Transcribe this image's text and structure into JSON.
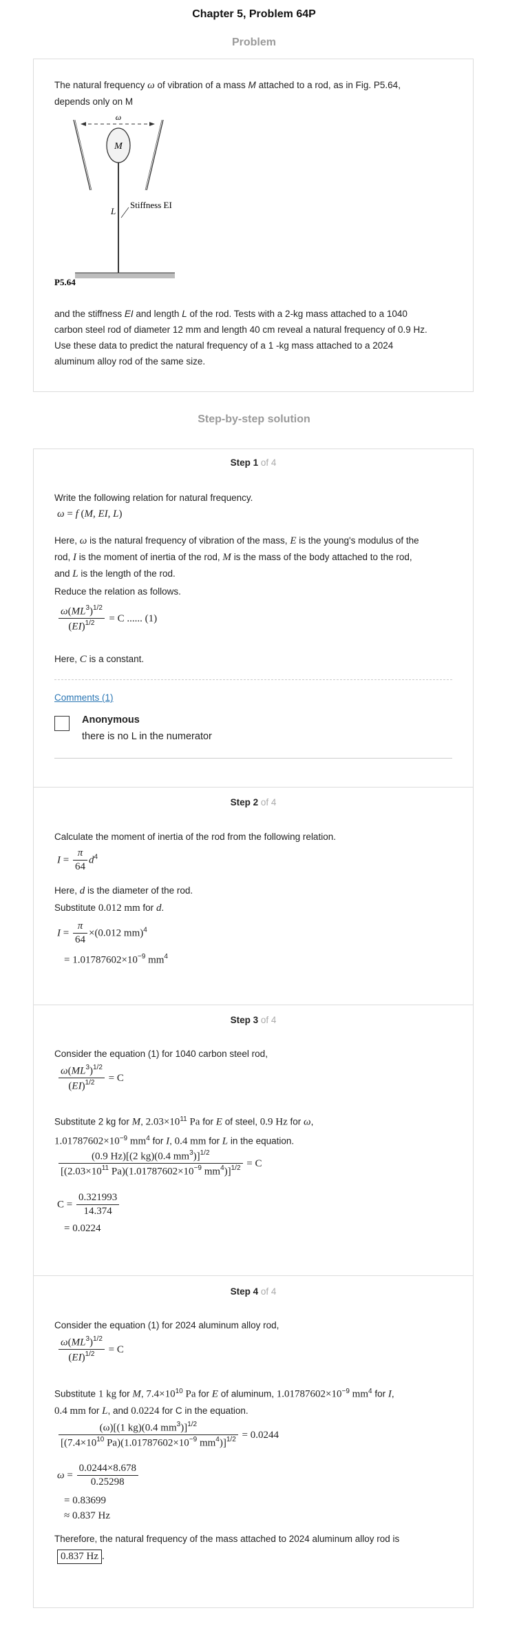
{
  "title": "Chapter 5, Problem 64P",
  "problem_heading": "Problem",
  "problem": {
    "line1a": "The natural frequency",
    "omega": "ω",
    "line1b": "of vibration of a mass",
    "mass_var": "M",
    "line1c": "attached to a rod, as in Fig. P5.64,",
    "line2": "depends only on M",
    "figure": {
      "omega_label": "ω",
      "mass_label": "M",
      "length_label": "L",
      "stiffness_label": "Stiffness EI",
      "figure_id": "P5.64"
    },
    "para2a": "and the stiffness",
    "ei": "EI",
    "para2b": "and length",
    "l": "L",
    "para2c": "of the rod. Tests with a 2-kg mass attached to a 1040",
    "para2_line2": "carbon steel rod of diameter 12 mm and length 40 cm reveal a natural frequency of 0.9 Hz.",
    "para2_line3": "Use these data to predict the natural frequency of a 1 -kg mass attached to a 2024",
    "para2_line4": "aluminum alloy rod of the same size."
  },
  "solution_heading": "Step-by-step solution",
  "steps": [
    {
      "label": "Step 1",
      "of": "of 4",
      "intro": "Write the following relation for natural frequency.",
      "eq1": "ω = f (M, EI, L)",
      "here1": "Here,",
      "here1_omega": "ω",
      "here1_a": "is the natural frequency of vibration of the mass,",
      "here1_e": "E",
      "here1_b": "is the young's modulus of the",
      "here1_line2a": "rod,",
      "here1_i": "I",
      "here1_line2b": "is the moment of inertia of the rod,",
      "here1_m": "M",
      "here1_line2c": "is the mass of the body attached to the rod,",
      "here1_line3a": "and",
      "here1_l": "L",
      "here1_line3b": "is the length of the rod.",
      "reduce": "Reduce the relation as follows.",
      "eq2_rhs": "= C ...... (1)",
      "here2": "Here,",
      "here2_c": "C",
      "here2_b": "is a constant.",
      "comments_link": "Comments (1)",
      "comment_author": "Anonymous",
      "comment_text": "there is no L in the numerator"
    },
    {
      "label": "Step 2",
      "of": "of 4",
      "intro": "Calculate the moment of inertia of the rod from the following relation.",
      "here": "Here,",
      "here_d": "d",
      "here_b": "is the diameter of the rod.",
      "subst_a": "Substitute",
      "subst_val": "0.012 mm",
      "subst_for": "for",
      "subst_d": "d",
      "result": "= 1.01787602×10",
      "result_exp": "−9",
      "result_unit": "mm",
      "paren": "(0.012 mm)"
    },
    {
      "label": "Step 3",
      "of": "of 4",
      "intro": "Consider the equation (1) for 1040 carbon steel rod,",
      "subst_line1": "Substitute 2 kg for",
      "subst_m": "M",
      "subst_e_val": "2.03×10",
      "subst_e_exp": "11",
      "subst_e_unit": "Pa",
      "subst_for": "for",
      "subst_e": "E",
      "subst_steel": "of steel,",
      "subst_hz": "0.9 Hz",
      "subst_omega": "ω",
      "subst_i_val": "1.01787602×10",
      "subst_i_exp": "−9",
      "subst_i_unit": "mm",
      "subst_i": "I",
      "subst_l_val": "0.4 mm",
      "subst_l": "L",
      "subst_end": "in the equation.",
      "num_a": "(0.9 Hz)",
      "num_b": "(2 kg)(0.4 mm",
      "den_a": "(2.03×10",
      "den_b": "Pa)(1.01787602×10",
      "den_c": "mm",
      "c_frac_num": "0.321993",
      "c_frac_den": "14.374",
      "c_result": "= 0.0224"
    },
    {
      "label": "Step 4",
      "of": "of 4",
      "intro": "Consider the equation (1) for 2024 aluminum alloy rod,",
      "subst_a": "Substitute",
      "subst_kg": "1 kg",
      "subst_for": "for",
      "subst_m": "M",
      "subst_e_val": "7.4×10",
      "subst_e_exp": "10",
      "subst_e_unit": "Pa",
      "subst_e": "E",
      "subst_al": "of aluminum,",
      "subst_i_val": "1.01787602×10",
      "subst_i_exp": "−9",
      "subst_i_unit": "mm",
      "subst_i": "I",
      "subst_l_val": "0.4 mm",
      "subst_l": "L",
      "subst_and": "and",
      "subst_c_val": "0.0224",
      "subst_end": "for C in the equation.",
      "num_a": "(ω)",
      "num_b": "(1 kg)(0.4 mm",
      "den_a": "(7.4×10",
      "den_b": "Pa)(1.01787602×10",
      "den_c": "mm",
      "rhs": "= 0.0244",
      "w_num": "0.0244×8.678",
      "w_den": "0.25298",
      "w_r1": "= 0.83699",
      "w_r2": "≈ 0.837 Hz",
      "conclusion": "Therefore, the natural frequency of the mass attached to 2024 aluminum alloy rod is",
      "answer": "0.837 Hz"
    }
  ]
}
